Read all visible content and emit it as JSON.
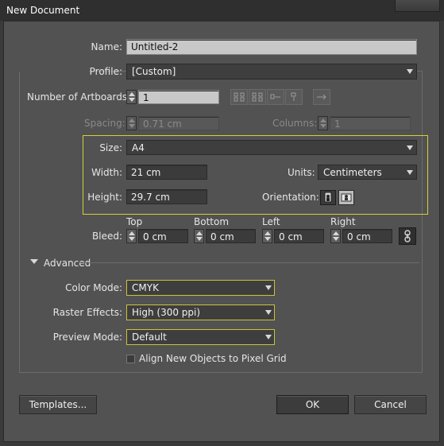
{
  "window": {
    "title": "New Document"
  },
  "name": {
    "label": "Name:",
    "value": "Untitled-2"
  },
  "profile": {
    "label": "Profile:",
    "value": "[Custom]"
  },
  "artboards": {
    "label": "Number of Artboards:",
    "value": "1"
  },
  "spacing": {
    "label": "Spacing:",
    "value": "0.71 cm"
  },
  "columns": {
    "label": "Columns:",
    "value": "1"
  },
  "size": {
    "label": "Size:",
    "value": "A4"
  },
  "width": {
    "label": "Width:",
    "value": "21 cm"
  },
  "units": {
    "label": "Units:",
    "value": "Centimeters"
  },
  "height": {
    "label": "Height:",
    "value": "29.7 cm"
  },
  "orientation": {
    "label": "Orientation:",
    "selected": "portrait"
  },
  "bleed": {
    "label": "Bleed:",
    "top": {
      "label": "Top",
      "value": "0 cm"
    },
    "bottom": {
      "label": "Bottom",
      "value": "0 cm"
    },
    "left": {
      "label": "Left",
      "value": "0 cm"
    },
    "right": {
      "label": "Right",
      "value": "0 cm"
    }
  },
  "advanced": {
    "label": "Advanced",
    "color_mode": {
      "label": "Color Mode:",
      "value": "CMYK"
    },
    "raster_effects": {
      "label": "Raster Effects:",
      "value": "High (300 ppi)"
    },
    "preview_mode": {
      "label": "Preview Mode:",
      "value": "Default"
    },
    "align_pixel_grid": {
      "label": "Align New Objects to Pixel Grid",
      "checked": false
    }
  },
  "buttons": {
    "templates": "Templates...",
    "ok": "OK",
    "cancel": "Cancel"
  },
  "colors": {
    "highlight": "#d6cf3a",
    "dialog_bg": "#525252",
    "field_bg": "#3b3b3b",
    "titlebar_bg": "#2f2f2f"
  }
}
